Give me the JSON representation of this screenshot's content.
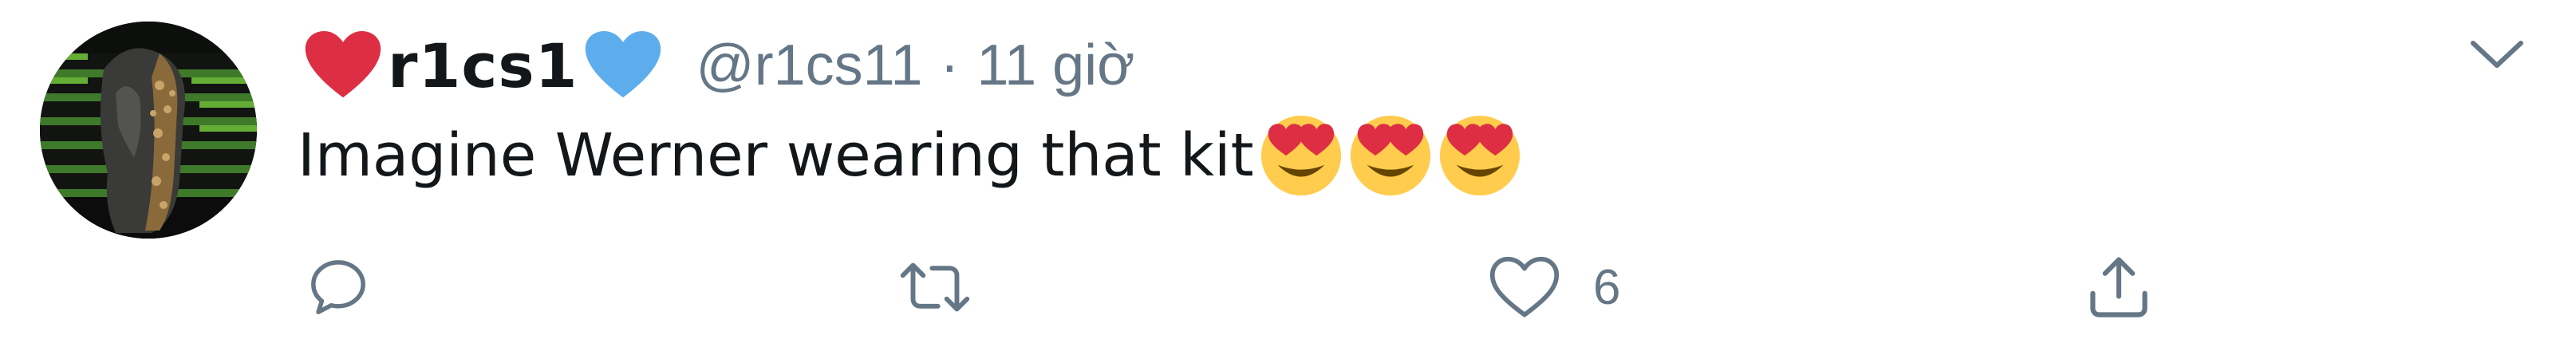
{
  "tweet": {
    "display_name": "r1cs1",
    "handle": "@r1cs11",
    "separator": "·",
    "timestamp": "11 giờ",
    "text": "Imagine Werner wearing that kit",
    "name_emoji_left": "red-heart-icon",
    "name_emoji_right": "blue-heart-icon",
    "text_emojis": [
      "heart-eyes-emoji",
      "heart-eyes-emoji",
      "heart-eyes-emoji"
    ]
  },
  "actions": {
    "reply": {
      "icon": "reply-icon",
      "count": ""
    },
    "retweet": {
      "icon": "retweet-icon",
      "count": ""
    },
    "like": {
      "icon": "like-icon",
      "count": "6"
    },
    "share": {
      "icon": "share-icon"
    }
  },
  "menu": {
    "icon": "chevron-down-icon"
  },
  "colors": {
    "text_primary": "#14171a",
    "text_secondary": "#657786",
    "red_heart": "#dd2e44",
    "blue_heart": "#5dadec",
    "emoji_face": "#ffcc4d"
  }
}
